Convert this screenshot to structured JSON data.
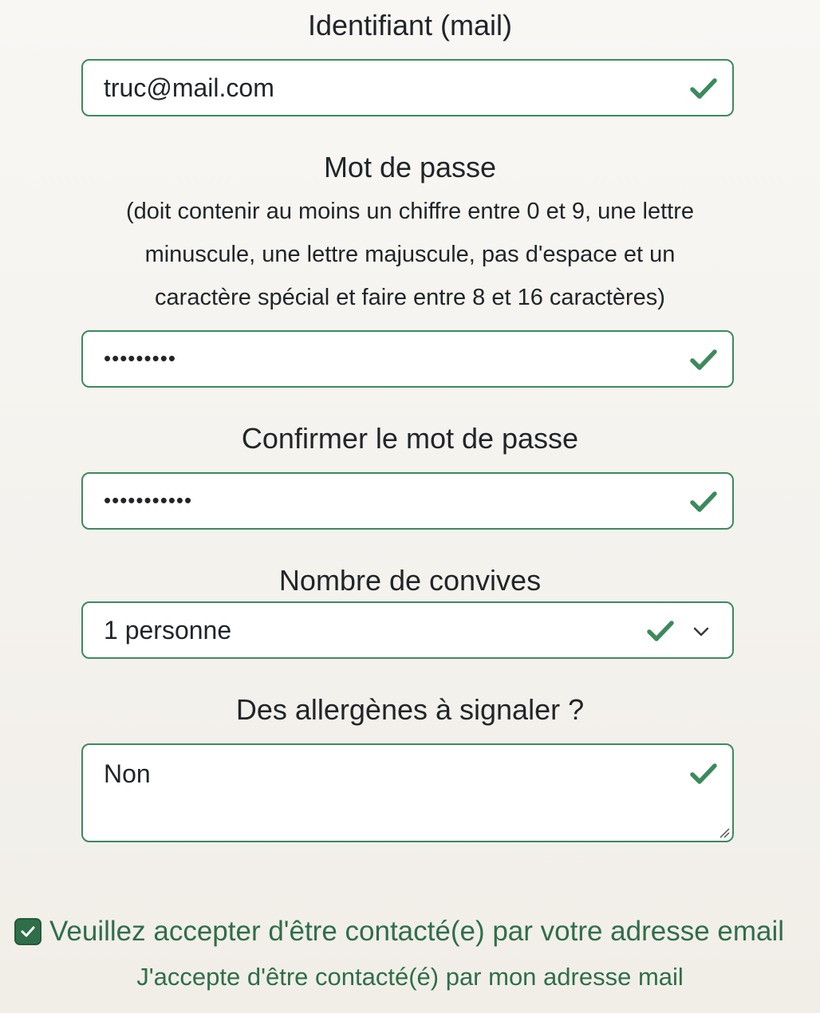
{
  "form": {
    "email_label": "Identifiant (mail)",
    "email_value": "truc@mail.com",
    "password_label": "Mot de passe",
    "password_hint": "(doit contenir au moins un chiffre entre 0 et 9, une lettre minuscule, une lettre majuscule, pas d'espace et un caractère spécial et faire entre 8 et 16 caractères)",
    "password_value": "•••••••••",
    "confirm_label": "Confirmer le mot de passe",
    "confirm_value": "•••••••••••",
    "guests_label": "Nombre de convives",
    "guests_value": "1 personne",
    "allergens_label": "Des allergènes à signaler ?",
    "allergens_value": "Non",
    "consent_label": "Veuillez accepter d'être contacté(e) par votre adresse email",
    "consent_checked": true,
    "consent_sub": "J'accepte d'être contacté(é) par mon adresse mail"
  },
  "icons": {
    "valid": "check-icon",
    "dropdown": "chevron-down-icon"
  },
  "colors": {
    "valid_green": "#3c8a5c",
    "consent_green": "#2f6e49",
    "text": "#212529"
  }
}
